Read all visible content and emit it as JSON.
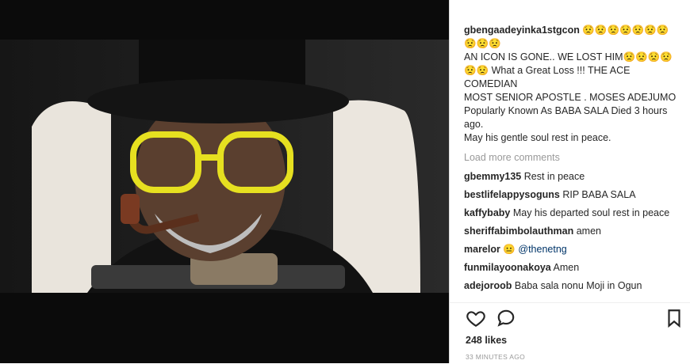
{
  "post": {
    "caption": {
      "username": "gbengaadeyinka1stgcon",
      "emoji_top": "😟😟😟😟😟😟😟😟😟😟",
      "line1": "AN ICON IS GONE.. WE LOST HIM",
      "line1_emoji": "😟😟😟😟😟😟",
      "line2": " What a Great Loss !!! THE ACE COMEDIAN",
      "line3": "MOST SENIOR APOSTLE . MOSES ADEJUMO Popularly Known As BABA SALA Died 3 hours ago.",
      "line4": "May his gentle soul rest in peace."
    },
    "load_more": "Load more comments",
    "comments": [
      {
        "username": "gbemmy135",
        "text": "Rest in peace"
      },
      {
        "username": "bestlifelappysoguns",
        "text": "RIP BABA SALA"
      },
      {
        "username": "kaffybaby",
        "text": "May his departed soul rest in peace"
      },
      {
        "username": "sheriffabimbolauthman",
        "text": "amen"
      },
      {
        "username": "marelor",
        "text": "😐 ",
        "mention": "@thenetng"
      },
      {
        "username": "funmilayoonakoya",
        "text": "Amen"
      },
      {
        "username": "adejoroob",
        "text": "Baba sala nonu Moji in Ogun"
      }
    ],
    "likes": "248 likes",
    "timestamp": "33 MINUTES AGO"
  },
  "icons": {
    "like": "heart-icon",
    "comment": "comment-icon",
    "save": "bookmark-icon"
  },
  "colors": {
    "text": "#262626",
    "muted": "#999999",
    "mention": "#003569",
    "border": "#dbdbdb"
  }
}
